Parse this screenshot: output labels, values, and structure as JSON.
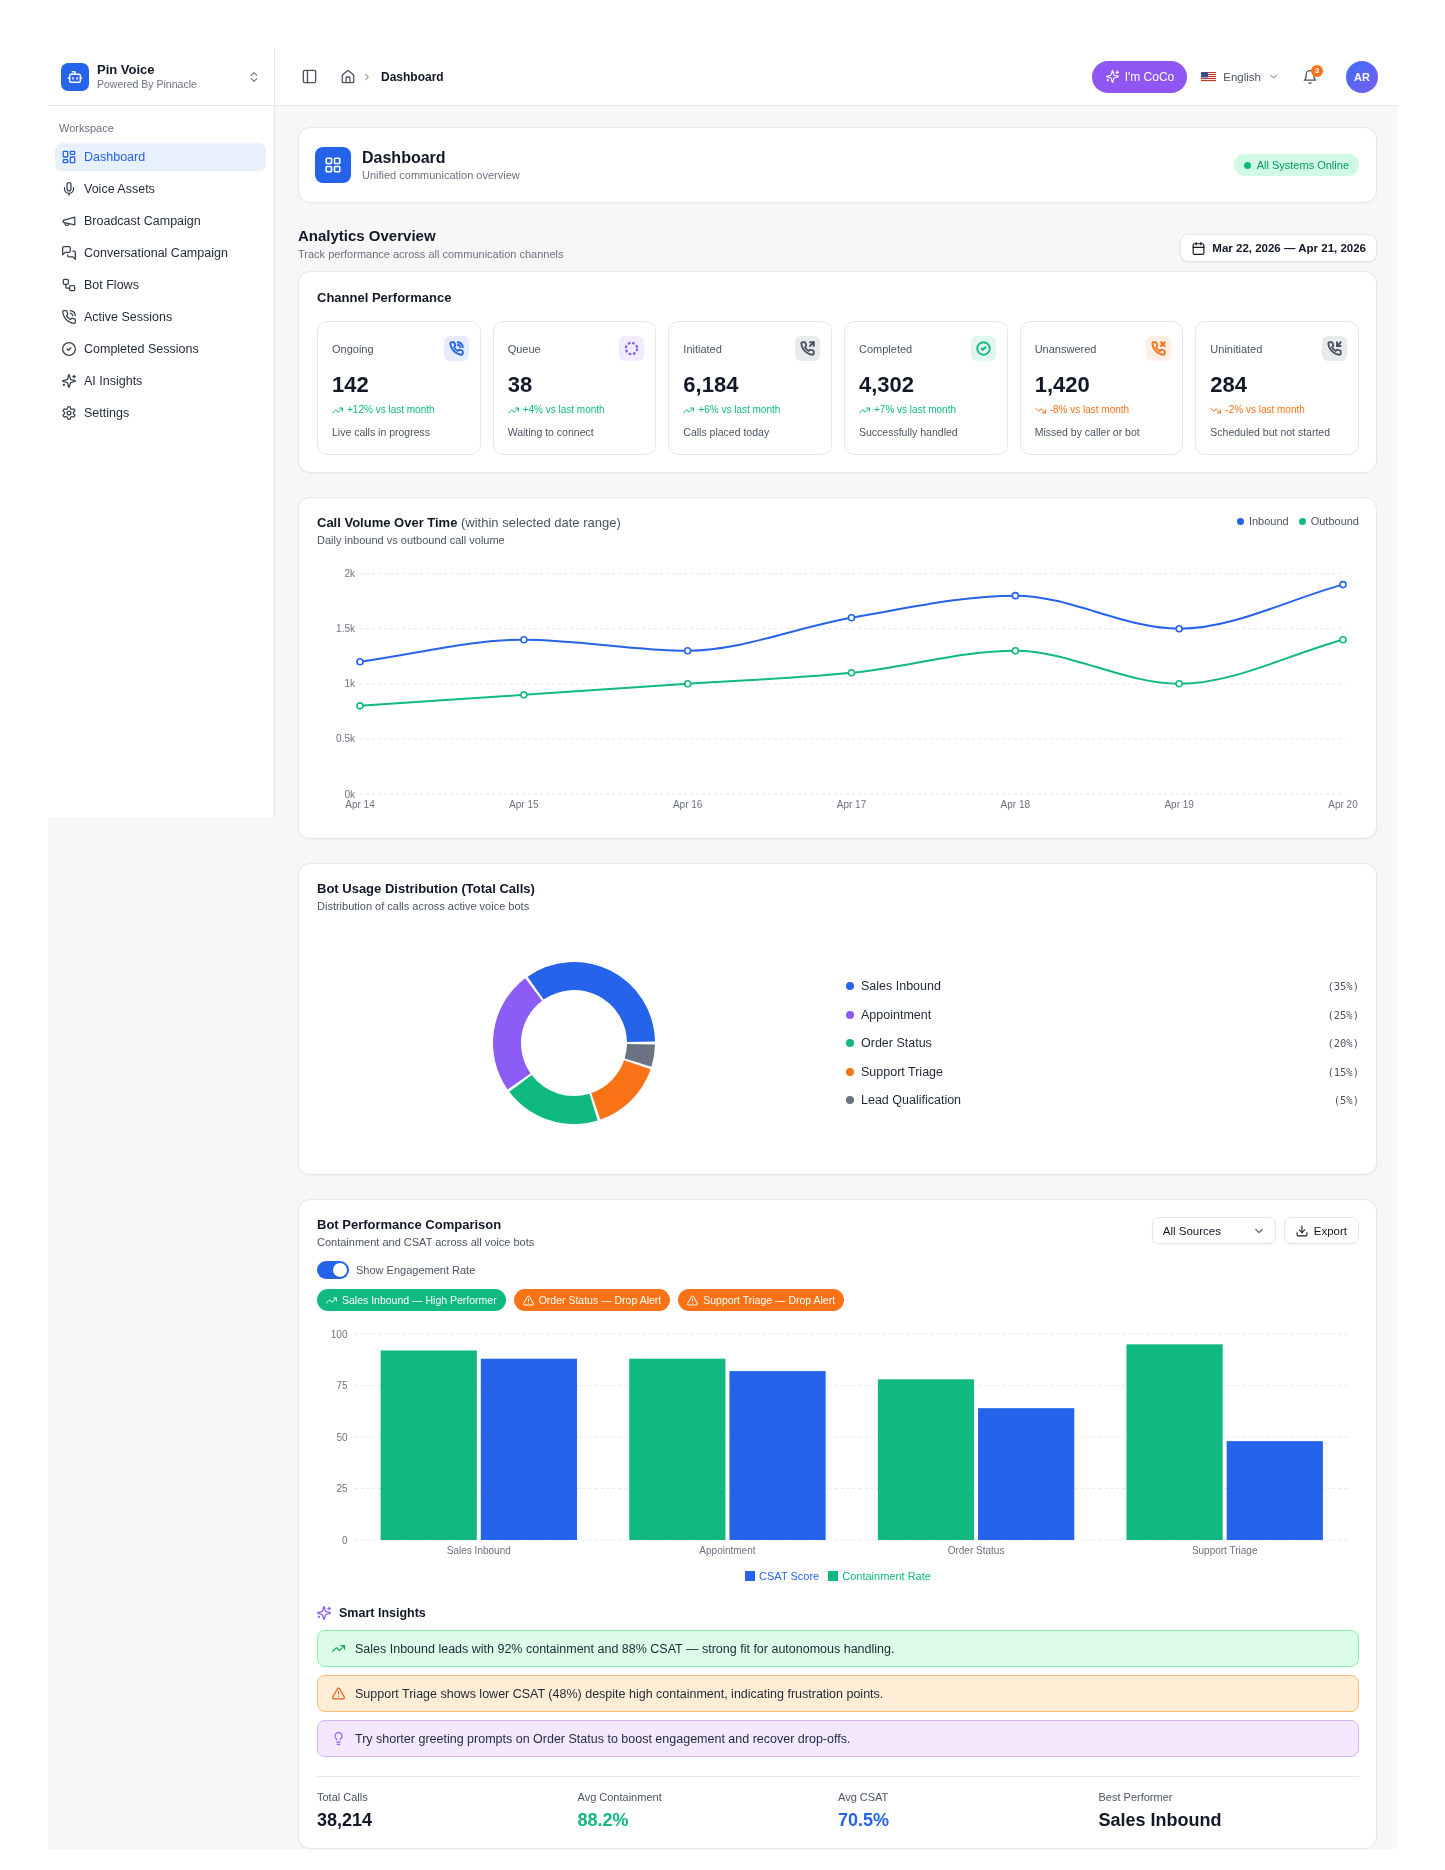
{
  "sidebar": {
    "brand": {
      "name": "Pin Voice",
      "tagline": "Powered By Pinnacle"
    },
    "section_label": "Workspace",
    "items": [
      {
        "label": "Dashboard",
        "selected": true
      },
      {
        "label": "Voice Assets",
        "selected": false
      },
      {
        "label": "Broadcast Campaign",
        "selected": false
      },
      {
        "label": "Conversational Campaign",
        "selected": false
      },
      {
        "label": "Bot Flows",
        "selected": false
      },
      {
        "label": "Active Sessions",
        "selected": false
      },
      {
        "label": "Completed Sessions",
        "selected": false
      },
      {
        "label": "AI Insights",
        "selected": false
      },
      {
        "label": "Settings",
        "selected": false
      }
    ]
  },
  "header": {
    "breadcrumb": "Dashboard",
    "assistant_button": "I'm CoCo",
    "language": "English",
    "notification_count": "3",
    "avatar_initials": "AR"
  },
  "page_header": {
    "title": "Dashboard",
    "subtitle": "Unified communication overview",
    "status": "All Systems Online"
  },
  "analytics": {
    "title": "Analytics Overview",
    "subtitle": "Track performance across all communication channels",
    "date_range": "Mar 22, 2026 — Apr 21, 2026"
  },
  "channel_performance": {
    "title": "Channel Performance",
    "cards": [
      {
        "label": "Ongoing",
        "value": "142",
        "positive": true,
        "trend": "+12% vs last month",
        "description": "Live calls in progress",
        "color": "#2563eb"
      },
      {
        "label": "Queue",
        "value": "38",
        "positive": true,
        "trend": "+4% vs last month",
        "description": "Waiting to connect",
        "color": "#8b5cf6"
      },
      {
        "label": "Initiated",
        "value": "6,184",
        "positive": true,
        "trend": "+6% vs last month",
        "description": "Calls placed today",
        "color": "#4b5563"
      },
      {
        "label": "Completed",
        "value": "4,302",
        "positive": true,
        "trend": "+7% vs last month",
        "description": "Successfully handled",
        "color": "#10b981"
      },
      {
        "label": "Unanswered",
        "value": "1,420",
        "positive": false,
        "trend": "-8% vs last month",
        "description": "Missed by caller or bot",
        "color": "#f97316"
      },
      {
        "label": "Uninitiated",
        "value": "284",
        "positive": false,
        "trend": "-2% vs last month",
        "description": "Scheduled but not started",
        "color": "#4b5563"
      }
    ]
  },
  "call_volume": {
    "title": "**Call Volume Over Time** (within selected date range)",
    "subtitle": "Daily inbound vs outbound call volume",
    "chart_data": {
      "type": "line",
      "categories": [
        "Apr 14",
        "Apr 15",
        "Apr 16",
        "Apr 17",
        "Apr 18",
        "Apr 19",
        "Apr 20"
      ],
      "series": [
        {
          "name": "Inbound",
          "color": "#2563eb",
          "marker": "circle",
          "values": [
            1200,
            1400,
            1300,
            1600,
            1800,
            1500,
            1900
          ]
        },
        {
          "name": "Outbound",
          "color": "#10b981",
          "marker": "circle",
          "values": [
            800,
            900,
            1000,
            1100,
            1300,
            1000,
            1400
          ]
        }
      ],
      "ylim": [
        0,
        2000
      ],
      "yticks": [
        {
          "value": 0,
          "label": "0k"
        },
        {
          "value": 500,
          "label": "0.5k"
        },
        {
          "value": 1000,
          "label": "1k"
        },
        {
          "value": 1500,
          "label": "1.5k"
        },
        {
          "value": 2000,
          "label": "2k"
        }
      ],
      "grid": true
    }
  },
  "bot_usage": {
    "title": "Bot Usage Distribution (Total Calls)",
    "subtitle": "Distribution of calls across active voice bots",
    "chart_data": {
      "type": "donut",
      "categories": [
        "Sales Inbound",
        "Appointment",
        "Order Status",
        "Support Triage",
        "Lead Qualification"
      ],
      "values": [
        35,
        25,
        20,
        15,
        5
      ]
    },
    "legend": [
      {
        "share": "(35%)",
        "color": "#2563eb"
      },
      {
        "share": "(25%)",
        "color": "#8b5cf6"
      },
      {
        "share": "(20%)",
        "color": "#10b981"
      },
      {
        "share": "(15%)",
        "color": "#f97316"
      },
      {
        "share": "(5%)",
        "color": "#6b7280"
      }
    ]
  },
  "bot_performance": {
    "title": "Bot Performance Comparison",
    "subtitle": "Containment and CSAT across all voice bots",
    "source_filter": "All Sources",
    "export_button": "Export",
    "engagement_toggle": {
      "label": "Show Engagement Rate",
      "on": true
    },
    "tags": [
      {
        "kind": "high",
        "label": "Sales Inbound — High Performer"
      },
      {
        "kind": "alert",
        "label": "Order Status — Drop Alert"
      },
      {
        "kind": "alert",
        "label": "Support Triage — Drop Alert"
      }
    ],
    "chart_data": {
      "type": "bar",
      "categories": [
        "Sales Inbound",
        "Appointment",
        "Order Status",
        "Support Triage"
      ],
      "series": [
        {
          "name": "Containment Rate",
          "color": "#10b981",
          "values": [
            92,
            88,
            78,
            95
          ]
        },
        {
          "name": "CSAT Score",
          "color": "#2563eb",
          "values": [
            88,
            82,
            64,
            48
          ]
        }
      ],
      "ylim": [
        0,
        100
      ],
      "yticks": [
        0,
        25,
        50,
        75,
        100
      ],
      "grid": true
    },
    "insights_title": "Smart Insights",
    "insights": [
      {
        "kind": "success",
        "text": "Sales Inbound leads with 92% containment and 88% CSAT — strong fit for autonomous handling."
      },
      {
        "kind": "warning",
        "text": "Support Triage shows lower CSAT (48%) despite high containment, indicating frustration points."
      },
      {
        "kind": "tip",
        "text": "Try shorter greeting prompts on Order Status to boost engagement and recover drop-offs."
      }
    ],
    "summary": [
      {
        "label": "Total Calls",
        "value": "38,214",
        "color": "#111827"
      },
      {
        "label": "Avg Containment",
        "value": "88.2%",
        "color": "#10b981"
      },
      {
        "label": "Avg CSAT",
        "value": "70.5%",
        "color": "#2563eb"
      },
      {
        "label": "Best Performer",
        "value": "Sales Inbound",
        "color": "#111827"
      }
    ]
  }
}
